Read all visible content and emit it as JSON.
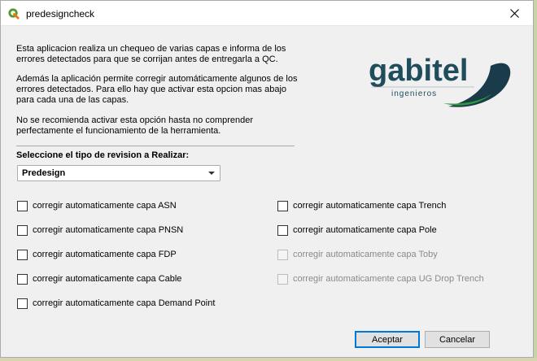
{
  "window": {
    "title": "predesigncheck"
  },
  "intro": {
    "p1_line1": "Esta aplicacion realiza un chequeo de varias capas e informa de los",
    "p1_line2": "errores detectados para que se corrijan antes de entregarla a QC.",
    "p2_line1": "Además la aplicación permite corregir automáticamente algunos de los",
    "p2_line2": "errores detectados. Para ello hay que activar esta opcion mas abajo",
    "p2_line3": "para cada una de las capas.",
    "p3_line1": "No se recomienda activar esta opción hasta no comprender",
    "p3_line2": "perfectamente el funcionamiento de la herramienta."
  },
  "logo": {
    "brand": "gabitel",
    "tagline": "ingenieros",
    "colors": {
      "text": "#1f4d5c",
      "dark": "#1a3b4a",
      "green": "#2e9a3a"
    }
  },
  "review": {
    "label": "Seleccione el tipo de revision a Realizar:",
    "selected": "Predesign"
  },
  "options_left": [
    {
      "label": "corregir automaticamente capa ASN"
    },
    {
      "label": "corregir automaticamente capa PNSN"
    },
    {
      "label": "corregir automaticamente capa FDP"
    },
    {
      "label": "corregir automaticamente capa Cable"
    },
    {
      "label": "corregir automaticamente capa Demand Point"
    }
  ],
  "options_right": [
    {
      "label": "corregir automaticamente capa Trench"
    },
    {
      "label": "corregir automaticamente capa Pole"
    },
    {
      "label": "corregir automaticamente capa Toby",
      "disabled": true
    },
    {
      "label": "corregir automaticamente capa UG Drop Trench",
      "disabled": true
    }
  ],
  "buttons": {
    "accept": "Aceptar",
    "cancel": "Cancelar"
  }
}
